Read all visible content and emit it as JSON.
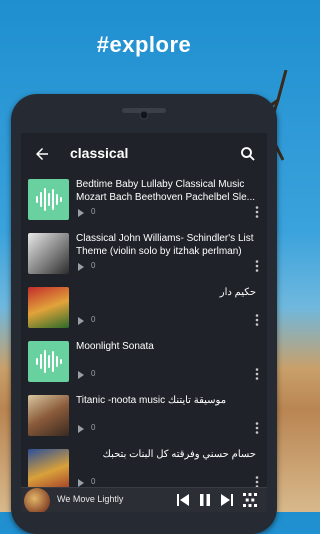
{
  "banner": {
    "title": "#explore"
  },
  "search": {
    "query": "classical"
  },
  "results": [
    {
      "title": "Bedtime Baby Lullaby Classical Music Mozart Bach Beethoven Pachelbel Sle...",
      "plays": "0",
      "thumb": "waveform",
      "rtl": false
    },
    {
      "title": "Classical  John Williams- Schindler's List Theme (violin solo by itzhak perlman)",
      "plays": "0",
      "thumb": "photo-bw",
      "rtl": false
    },
    {
      "title": "حكيم دار",
      "plays": "0",
      "thumb": "photo-color",
      "rtl": true
    },
    {
      "title": "Moonlight Sonata",
      "plays": "0",
      "thumb": "waveform",
      "rtl": false
    },
    {
      "title": "Titanic -noota music موسيقة تايتنك",
      "plays": "0",
      "thumb": "photo-titanic",
      "rtl": false
    },
    {
      "title": "حسام حسني وفرقته كل البنات بتحبك",
      "plays": "0",
      "thumb": "photo-poster",
      "rtl": true
    }
  ],
  "player": {
    "now_playing": "We Move Lightly"
  },
  "colors": {
    "accent": "#69d1a0",
    "screen_bg": "#1f2228"
  },
  "icons": [
    "back-arrow-icon",
    "search-icon",
    "play-icon",
    "more-vert-icon",
    "skip-previous-icon",
    "pause-icon",
    "skip-next-icon",
    "shuffle-grid-icon"
  ]
}
